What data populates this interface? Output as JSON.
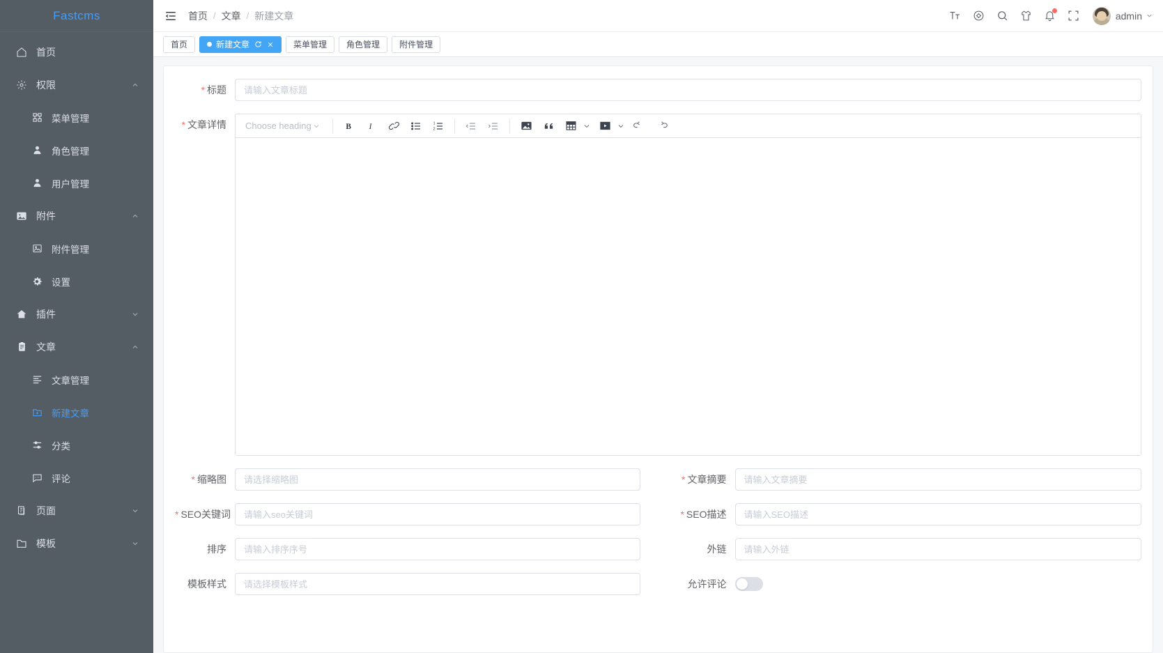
{
  "brand": {
    "name": "Fastcms"
  },
  "sidebar": {
    "items": [
      {
        "label": "首页",
        "icon": "home-icon",
        "level": 1,
        "arrow": "none",
        "active": false
      },
      {
        "label": "权限",
        "icon": "gear-icon",
        "level": 1,
        "arrow": "up",
        "active": false
      },
      {
        "label": "菜单管理",
        "icon": "grid-icon",
        "level": 2,
        "arrow": "none",
        "active": false
      },
      {
        "label": "角色管理",
        "icon": "user-icon",
        "level": 2,
        "arrow": "none",
        "active": false
      },
      {
        "label": "用户管理",
        "icon": "user-icon",
        "level": 2,
        "arrow": "none",
        "active": false
      },
      {
        "label": "附件",
        "icon": "image-icon",
        "level": 1,
        "arrow": "up",
        "active": false
      },
      {
        "label": "附件管理",
        "icon": "picture-icon",
        "level": 2,
        "arrow": "none",
        "active": false
      },
      {
        "label": "设置",
        "icon": "gear-icon",
        "level": 2,
        "arrow": "none",
        "active": false
      },
      {
        "label": "插件",
        "icon": "plugin-home-icon",
        "level": 1,
        "arrow": "down",
        "active": false
      },
      {
        "label": "文章",
        "icon": "document-icon",
        "level": 1,
        "arrow": "up",
        "active": false
      },
      {
        "label": "文章管理",
        "icon": "list-icon",
        "level": 2,
        "arrow": "none",
        "active": false
      },
      {
        "label": "新建文章",
        "icon": "folder-add-icon",
        "level": 2,
        "arrow": "none",
        "active": true
      },
      {
        "label": "分类",
        "icon": "sliders-icon",
        "level": 2,
        "arrow": "none",
        "active": false
      },
      {
        "label": "评论",
        "icon": "comment-icon",
        "level": 2,
        "arrow": "none",
        "active": false
      },
      {
        "label": "页面",
        "icon": "copy-doc-icon",
        "level": 1,
        "arrow": "down",
        "active": false
      },
      {
        "label": "模板",
        "icon": "folder-icon",
        "level": 1,
        "arrow": "down",
        "active": false
      }
    ]
  },
  "header": {
    "hamburger_icon": "hamburger-icon",
    "breadcrumb": [
      "首页",
      "文章",
      "新建文章"
    ],
    "separator": "/",
    "icons": [
      {
        "name": "font-size-icon",
        "badge": false
      },
      {
        "name": "theme-color-icon",
        "badge": false
      },
      {
        "name": "search-icon",
        "badge": false
      },
      {
        "name": "skin-shirt-icon",
        "badge": false
      },
      {
        "name": "bell-icon",
        "badge": true
      },
      {
        "name": "fullscreen-icon",
        "badge": false
      }
    ],
    "username": "admin"
  },
  "tabs": [
    {
      "label": "首页",
      "active": false,
      "closable": false
    },
    {
      "label": "新建文章",
      "active": true,
      "closable": true
    },
    {
      "label": "菜单管理",
      "active": false,
      "closable": false
    },
    {
      "label": "角色管理",
      "active": false,
      "closable": false
    },
    {
      "label": "附件管理",
      "active": false,
      "closable": false
    }
  ],
  "form": {
    "title": {
      "label": "标题",
      "required": true,
      "placeholder": "请输入文章标题",
      "value": ""
    },
    "detail": {
      "label": "文章详情",
      "required": true,
      "value": ""
    },
    "thumbnail": {
      "label": "缩略图",
      "required": true,
      "placeholder": "请选择缩略图",
      "value": ""
    },
    "summary": {
      "label": "文章摘要",
      "required": true,
      "placeholder": "请输入文章摘要",
      "value": ""
    },
    "seo_keywords": {
      "label": "SEO关键词",
      "required": true,
      "placeholder": "请输入seo关键词",
      "value": ""
    },
    "seo_description": {
      "label": "SEO描述",
      "required": true,
      "placeholder": "请输入SEO描述",
      "value": ""
    },
    "sort": {
      "label": "排序",
      "required": false,
      "placeholder": "请输入排序序号",
      "value": ""
    },
    "outlink": {
      "label": "外链",
      "required": false,
      "placeholder": "请输入外链",
      "value": ""
    },
    "template_style": {
      "label": "模板样式",
      "required": false,
      "placeholder": "请选择模板样式",
      "value": ""
    },
    "allow_comment": {
      "label": "允许评论",
      "required": false,
      "checked": false
    }
  },
  "editor": {
    "heading_placeholder": "Choose heading",
    "buttons": [
      {
        "name": "bold-icon",
        "title": "B"
      },
      {
        "name": "italic-icon",
        "title": "I"
      },
      {
        "name": "link-icon",
        "title": "link"
      },
      {
        "name": "bullet-list-icon",
        "title": "ul"
      },
      {
        "name": "ordered-list-icon",
        "title": "ol"
      },
      {
        "name": "outdent-icon",
        "title": "outdent"
      },
      {
        "name": "indent-icon",
        "title": "indent"
      },
      {
        "name": "image-icon",
        "title": "image"
      },
      {
        "name": "quote-icon",
        "title": "quote"
      },
      {
        "name": "table-icon",
        "title": "table"
      },
      {
        "name": "video-icon",
        "title": "video"
      },
      {
        "name": "undo-icon",
        "title": "undo"
      },
      {
        "name": "redo-icon",
        "title": "redo"
      }
    ]
  },
  "colors": {
    "sidebar_bg": "#545c64",
    "accent": "#409eff",
    "tab_active": "#42a5f5",
    "required_star": "#f56c6c",
    "badge": "#f56c6c"
  }
}
